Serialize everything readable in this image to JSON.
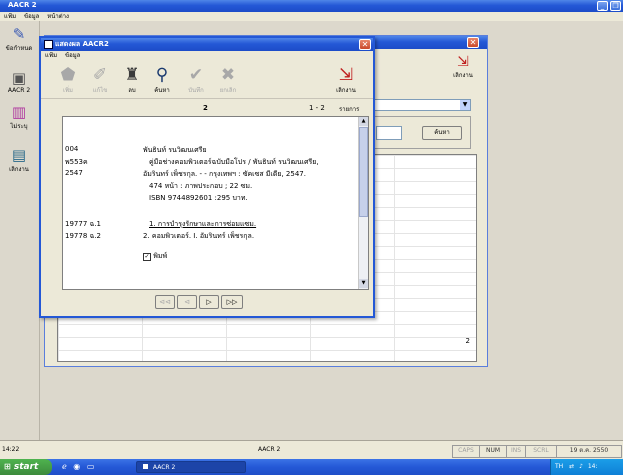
{
  "app": {
    "title": "AACR 2",
    "menu": [
      "แฟ้ม",
      "ข้อมูล",
      "หน้าต่าง"
    ],
    "sidebar": [
      {
        "label": "ข้อกำหนด",
        "icon": "pencil-icon"
      },
      {
        "label": "AACR 2",
        "icon": "printer-icon"
      },
      {
        "label": "ไม่ระบุ",
        "icon": "books-icon"
      },
      {
        "label": "เลิกงาน",
        "icon": "exit-icon"
      }
    ],
    "status_time": "14:22",
    "status_title": "AACR 2",
    "status_cells": [
      "CAPS",
      "NUM",
      "INS",
      "SCRL",
      "19 ต.ค. 2550"
    ]
  },
  "back_window": {
    "exit_label": "เลิกงาน",
    "search_button": "ค้นหา",
    "row_count": "2"
  },
  "dialog": {
    "title": "แสดงผล AACR2",
    "menu": [
      "แฟ้ม",
      "ข้อมูล"
    ],
    "tools": [
      {
        "label": "เพิ่ม",
        "icon": "add-record-icon",
        "disabled": true
      },
      {
        "label": "แก้ไข",
        "icon": "edit-icon",
        "disabled": true
      },
      {
        "label": "ลบ",
        "icon": "bottle-icon",
        "disabled": false
      },
      {
        "label": "ค้นหา",
        "icon": "search-binoculars-icon",
        "disabled": false
      },
      {
        "label": "บันทึก",
        "icon": "check-icon",
        "disabled": true
      },
      {
        "label": "ยกเลิก",
        "icon": "cancel-x-icon",
        "disabled": true
      }
    ],
    "exit_label": "เลิกงาน",
    "record_number": "2",
    "range": "1 - 2",
    "range_unit": "รายการ",
    "record": {
      "tag_author": "004",
      "tag_callno": "พ553ค",
      "tag_year": "2547",
      "author": "พันธินท์ รนวิฒนเศรีย",
      "title_line1": "คู่มือช่างคอมพิวเตอร์ฉบับมือโปร / พันธินท์ รนวิฒนเศรีย,",
      "title_line2": "อัมรินทร์ เพ็ชรกุล. - - กรุงเทพฯ : ซัคเซส มีเดีย, 2547.",
      "collation": "474 หน้า : ภาพประกอบ ; 22 ซม.",
      "isbn": "ISBN 9744892601 :295 บาท.",
      "tag_subj1": "19777 ฉ.1",
      "tag_subj2": "19778 ฉ.2",
      "subject1": "1. การบำรุงรักษาและการซ่อมแซม.",
      "subject2": "2. คอมพิวเตอร์. I. อัมรินทร์ เพ็ชรกุล.",
      "print_label": "พิมพ์"
    }
  },
  "taskbar": {
    "start_label": "start",
    "task_label": "AACR 2",
    "lang": "TH"
  },
  "colors": {
    "xp_blue": "#2458d6",
    "taskbar_green": "#3c8a3c",
    "dialog_face": "#ece9d8"
  }
}
